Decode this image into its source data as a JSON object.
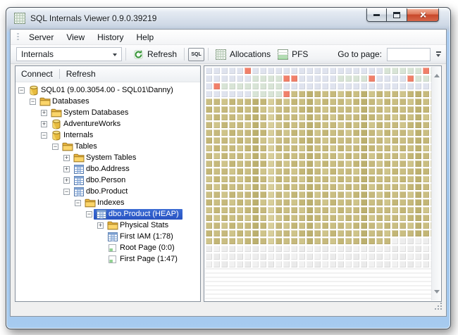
{
  "window": {
    "title": "SQL Internals Viewer 0.9.0.39219"
  },
  "menu": {
    "items": [
      "Server",
      "View",
      "History",
      "Help"
    ]
  },
  "toolbar": {
    "view_select": "Internals",
    "refresh_label": "Refresh",
    "sql_label": "SQL",
    "allocations_label": "Allocations",
    "pfs_label": "PFS",
    "goto_label": "Go to page:",
    "goto_value": ""
  },
  "explorer": {
    "connect_label": "Connect",
    "refresh_label": "Refresh",
    "tree": [
      {
        "label": "SQL01 (9.00.3054.00 - SQL01\\Danny)",
        "level": 0,
        "expander": "-",
        "icon": "database"
      },
      {
        "label": "Databases",
        "level": 1,
        "expander": "-",
        "icon": "folder"
      },
      {
        "label": "System Databases",
        "level": 2,
        "expander": "+",
        "icon": "folder"
      },
      {
        "label": "AdventureWorks",
        "level": 2,
        "expander": "+",
        "icon": "database"
      },
      {
        "label": "Internals",
        "level": 2,
        "expander": "-",
        "icon": "database"
      },
      {
        "label": "Tables",
        "level": 3,
        "expander": "-",
        "icon": "folder"
      },
      {
        "label": "System Tables",
        "level": 4,
        "expander": "+",
        "icon": "folder"
      },
      {
        "label": "dbo.Address",
        "level": 4,
        "expander": "+",
        "icon": "table"
      },
      {
        "label": "dbo.Person",
        "level": 4,
        "expander": "+",
        "icon": "table"
      },
      {
        "label": "dbo.Product",
        "level": 4,
        "expander": "-",
        "icon": "table"
      },
      {
        "label": "Indexes",
        "level": 5,
        "expander": "-",
        "icon": "folder"
      },
      {
        "label": "dbo.Product (HEAP)",
        "level": 6,
        "expander": "-",
        "icon": "table",
        "selected": true
      },
      {
        "label": "Physical Stats",
        "level": 7,
        "expander": "+",
        "icon": "folder"
      },
      {
        "label": "First IAM (1:78)",
        "level": 7,
        "expander": "",
        "icon": "table"
      },
      {
        "label": "Root Page (0:0)",
        "level": 7,
        "expander": "",
        "icon": "page"
      },
      {
        "label": "First Page (1:47)",
        "level": 7,
        "expander": "",
        "icon": "page"
      }
    ]
  },
  "allocation_map": {
    "columns": 30,
    "legend": {
      "b": [
        "#dfe3ee"
      ],
      "g": [
        "#d8e4d6"
      ],
      "r": [
        "#f0806a"
      ],
      "t": [
        "#cabe82",
        "#c6b97c",
        "#cfc48a",
        "#c3b676"
      ],
      "w": [
        "#ededed",
        "#f1f1f1",
        "#eaeaea"
      ]
    },
    "tan_dark_column": "#bcb06e",
    "tan_light_column": "#d8ce9a",
    "rows": [
      "bbbbbrbbbbbbbbbbbbbbbbbgggggrg",
      "bbbbbbggggrrbbbbbggggrbbbbrggg",
      "brggggggggbbbbbbbbbbbbbbbbbbbb",
      "bbbbbbggggrttttttttttttttttttt",
      "tttttttttttttttttttttttttttttt",
      "tttttttttttttttttttttttttttttt",
      "tttttttttttttttttttttttttttttt",
      "tttttttttttttttttttttttttttttt",
      "tttttttttttttttttttttttttttttt",
      "tttttttttttttttttttttttttttttt",
      "tttttttttttttttttttttttttttttt",
      "tttttttttttttttttttttttttttttt",
      "tttttttttttttttttttttttttttttt",
      "tttttttttttttttttttttttttttttt",
      "tttttttttttttttttttttttttttttt",
      "tttttttttttttttttttttttttttttt",
      "tttttttttttttttttttttttttttttt",
      "tttttttttttttttttttttttttttttt",
      "tttttttttttttttttttttttttttttt",
      "tttttttttttttttttttttttttttttt",
      "tttttttttttttttttttttttttttttt",
      "tttttttttttttttttttttttttttttt",
      "ttttttttttttttttttttttttwwwwww",
      "wwwwwwwwwwwwwwwwwwwwwwwwwwwwww",
      "wwwwwwwwwwwwwwwwwwwwwwwwwwwwww",
      "wwwwwwwwwwwwwwwwwwwwwwwwwwwwww"
    ]
  }
}
